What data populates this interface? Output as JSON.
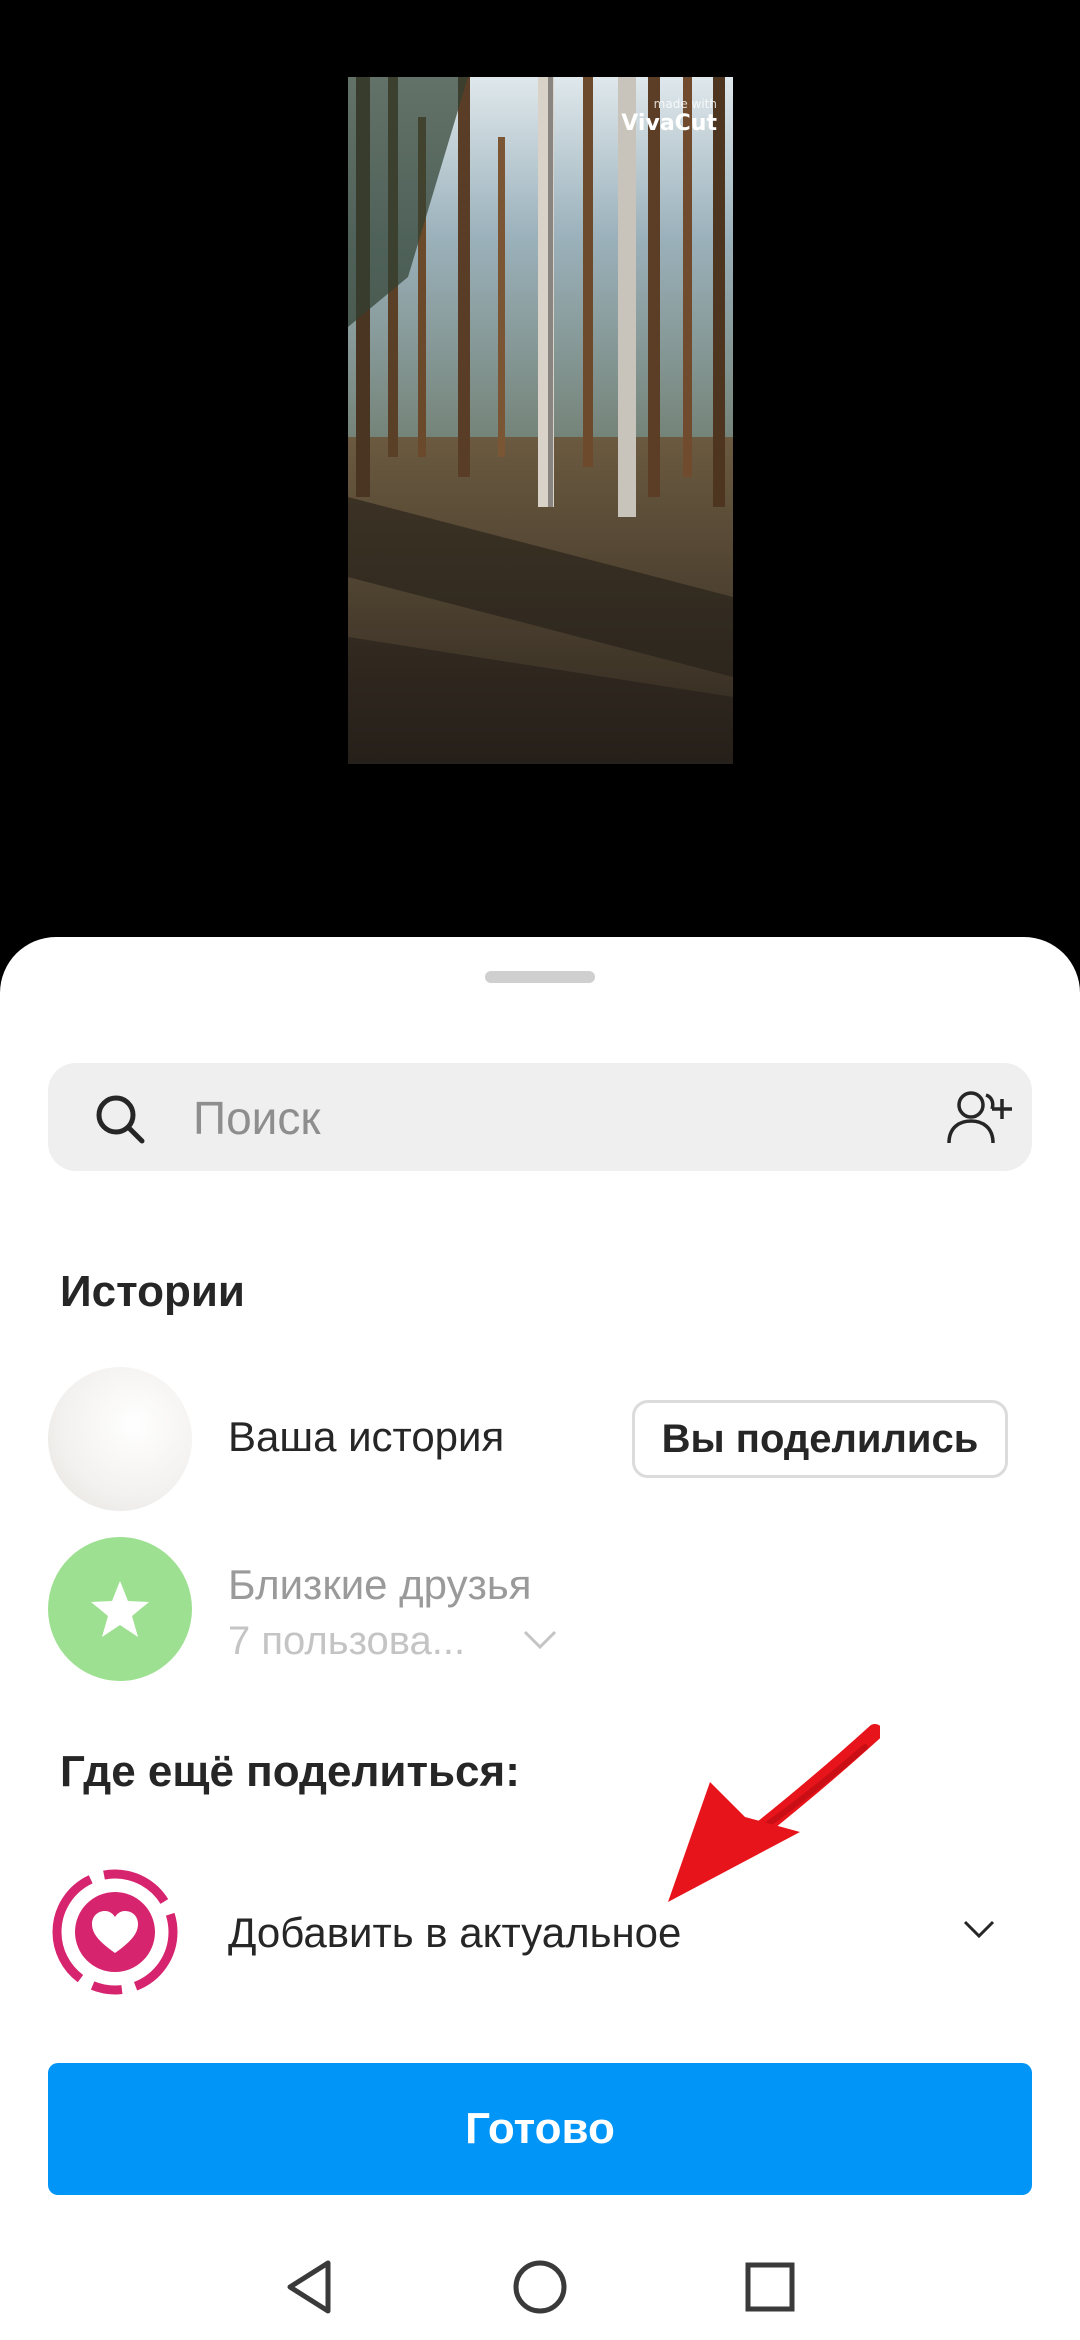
{
  "preview": {
    "watermark_small": "made with",
    "watermark_brand": "VivaCut"
  },
  "search": {
    "placeholder": "Поиск"
  },
  "stories": {
    "title": "Истории",
    "your_story_label": "Ваша история",
    "shared_button": "Вы поделились",
    "close_friends_label": "Близкие друзья",
    "close_friends_sub": "7 пользова..."
  },
  "share_more": {
    "title": "Где ещё поделиться:",
    "highlight_label": "Добавить в актуальное"
  },
  "done_button": "Готово",
  "colors": {
    "accent": "#0095f6",
    "highlight_icon": "#d6246e",
    "close_friends": "#9ee092",
    "annotation_arrow": "#e8141b"
  },
  "icons": {
    "search": "search-icon",
    "add_friends": "add-friends-icon",
    "star": "star-icon",
    "heart": "heart-icon",
    "chevron": "chevron-down-icon",
    "nav_back": "nav-back-icon",
    "nav_home": "nav-home-icon",
    "nav_recents": "nav-recents-icon"
  }
}
